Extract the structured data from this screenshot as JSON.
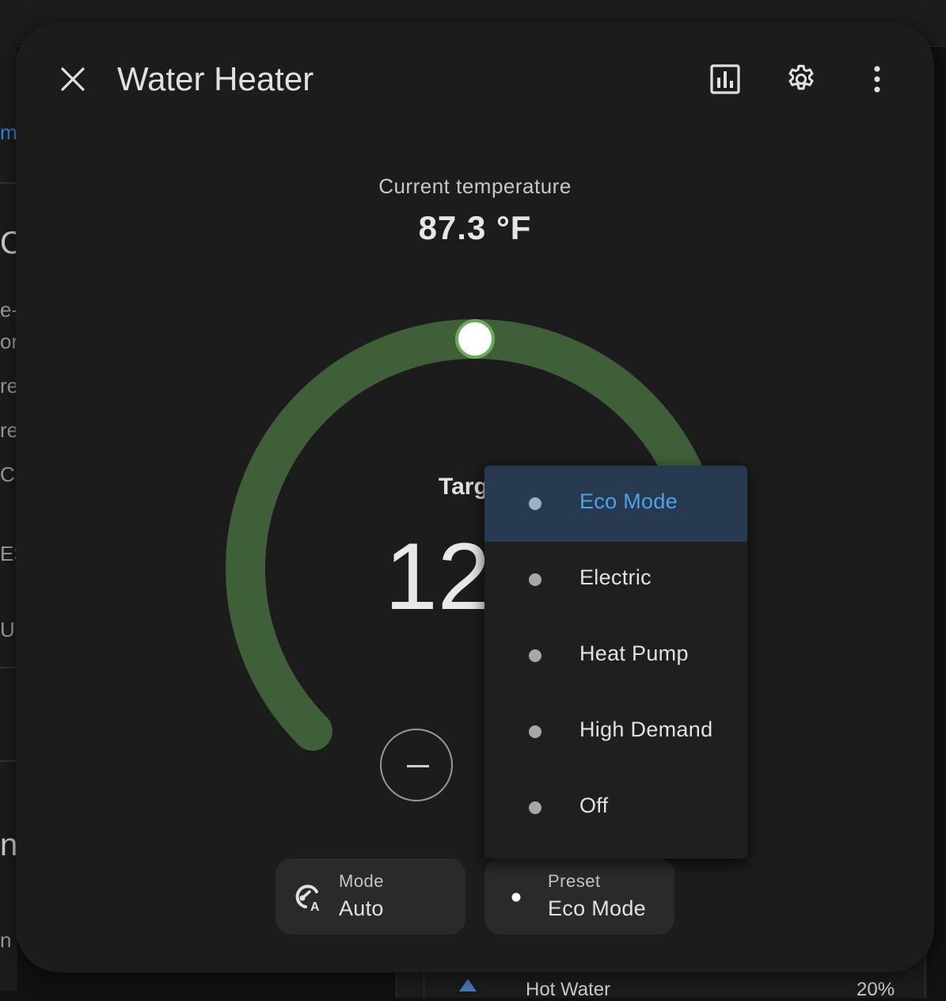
{
  "dialog": {
    "title": "Water Heater",
    "icons": [
      "close-icon",
      "history-chart-icon",
      "settings-gear-icon",
      "more-vertical-icon"
    ]
  },
  "current": {
    "label": "Current temperature",
    "value": "87.3 °F"
  },
  "target": {
    "label": "Targ",
    "value": "12",
    "dial_level": 0.5
  },
  "chips": {
    "mode": {
      "label": "Mode",
      "value": "Auto",
      "icon": "thermostat-auto-icon"
    },
    "preset": {
      "label": "Preset",
      "value": "Eco Mode",
      "icon": "dot-icon"
    }
  },
  "menu": {
    "items": [
      {
        "label": "Eco Mode",
        "selected": true
      },
      {
        "label": "Electric",
        "selected": false
      },
      {
        "label": "Heat Pump",
        "selected": false
      },
      {
        "label": "High Demand",
        "selected": false
      },
      {
        "label": "Off",
        "selected": false
      }
    ]
  },
  "background": {
    "fragments": [
      "mi",
      "C",
      "e-",
      "or",
      "re:",
      "re",
      "C:",
      "ES",
      "Un",
      "n",
      "n"
    ],
    "bottom_left": "Hot Water",
    "bottom_right": "20%"
  },
  "colors": {
    "dialog_bg": "#1c1c1c",
    "dial_track": "#3f5f38",
    "dial_knob_ring": "#6aa85a",
    "menu_selected_bg": "#273a4f",
    "accent_blue": "#4ba3e8"
  }
}
